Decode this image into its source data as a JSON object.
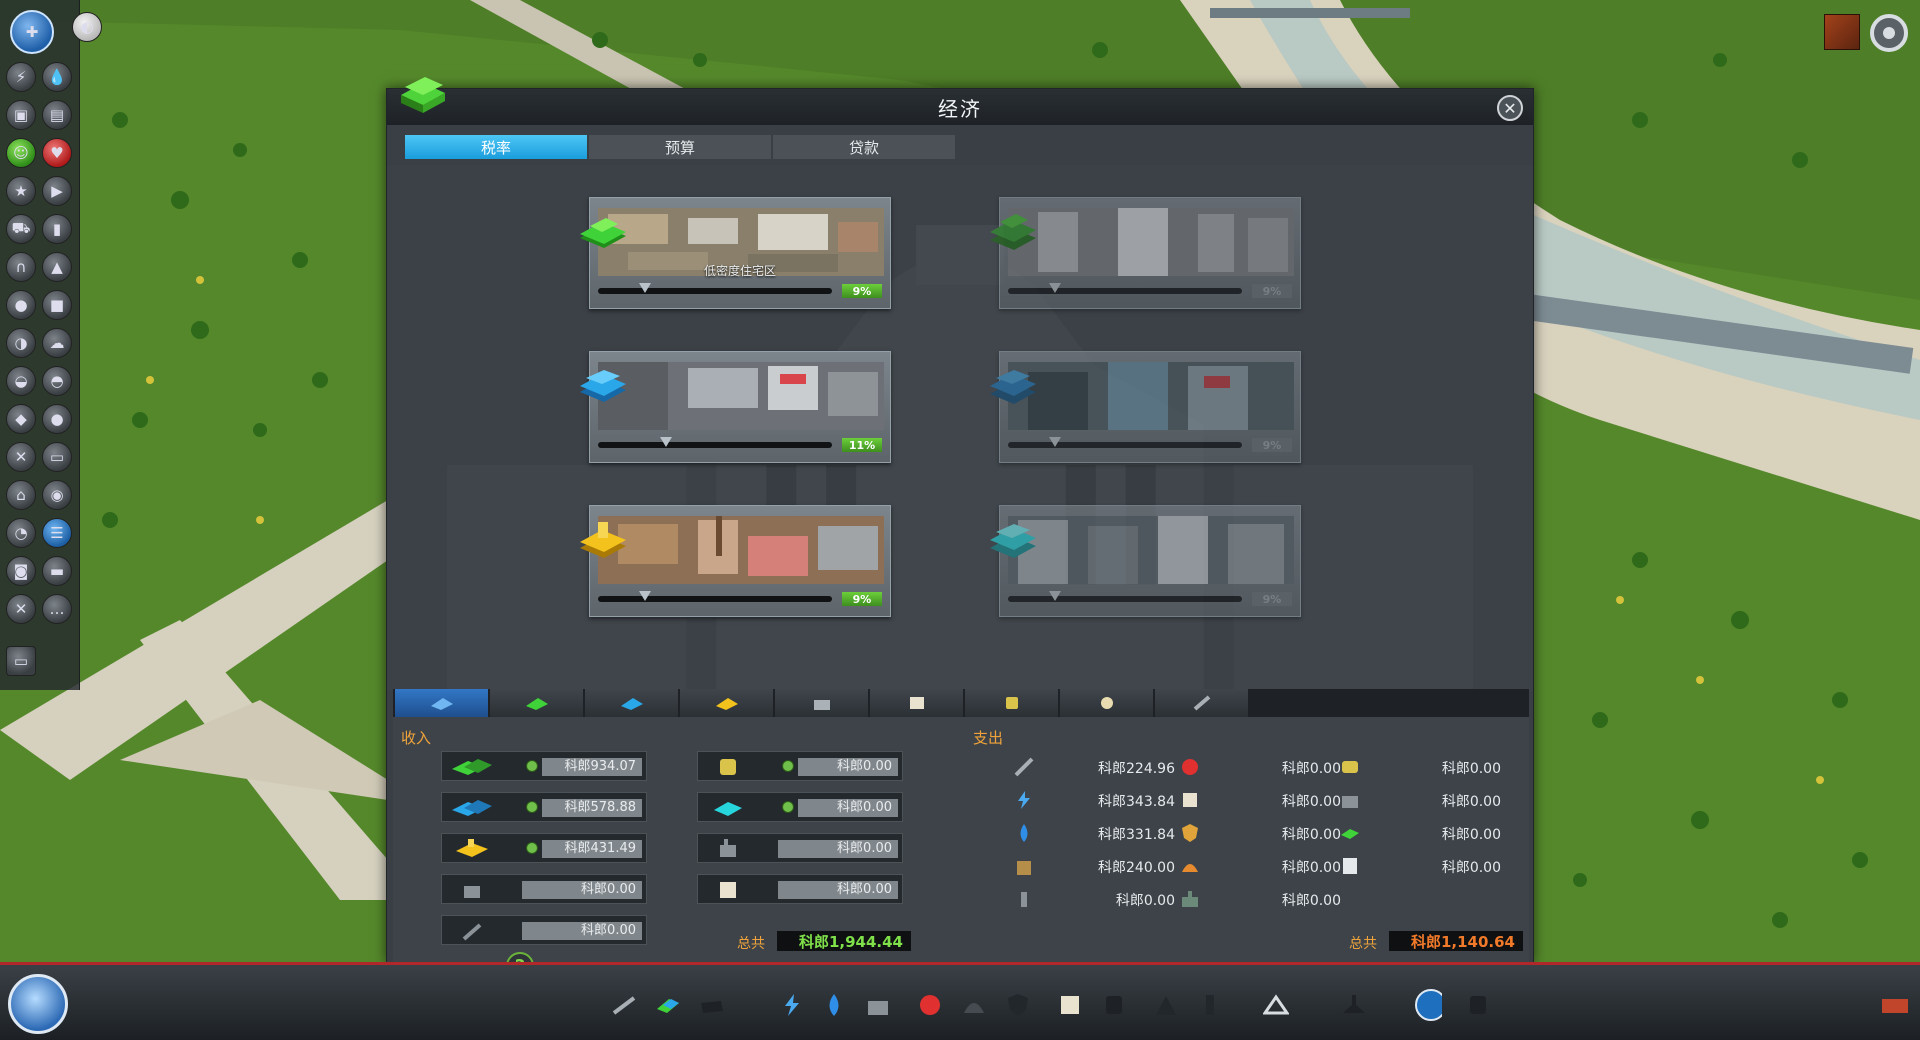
{
  "panel": {
    "title": "经济",
    "tabs": [
      {
        "label": "税率",
        "active": true
      },
      {
        "label": "预算",
        "active": false
      },
      {
        "label": "贷款",
        "active": false
      }
    ]
  },
  "zones": [
    {
      "name": "residential-low",
      "caption": "低密度住宅区",
      "tax": "9%",
      "tax_fraction": 0.2,
      "enabled": true,
      "icon_color": "#3fd339"
    },
    {
      "name": "residential-high",
      "caption": "",
      "tax": "9%",
      "tax_fraction": 0.2,
      "enabled": false,
      "icon_color": "#2f9a2a"
    },
    {
      "name": "commercial-low",
      "caption": "",
      "tax": "11%",
      "tax_fraction": 0.29,
      "enabled": true,
      "icon_color": "#2aa7e8"
    },
    {
      "name": "commercial-high",
      "caption": "",
      "tax": "9%",
      "tax_fraction": 0.2,
      "enabled": false,
      "icon_color": "#1f78b8"
    },
    {
      "name": "industrial",
      "caption": "",
      "tax": "9%",
      "tax_fraction": 0.2,
      "enabled": true,
      "icon_color": "#f3c21c"
    },
    {
      "name": "office",
      "caption": "",
      "tax": "9%",
      "tax_fraction": 0.2,
      "enabled": false,
      "icon_color": "#27d6dc"
    }
  ],
  "budget": {
    "income_label": "收入",
    "expense_label": "支出",
    "income_left": [
      {
        "icon": "residential-income-icon",
        "value": "科郎934.07",
        "locked": false
      },
      {
        "icon": "commercial-income-icon",
        "value": "科郎578.88",
        "locked": false
      },
      {
        "icon": "industrial-income-icon",
        "value": "科郎431.49",
        "locked": false
      },
      {
        "icon": "industry-specialization-icon",
        "value": "科郎0.00",
        "locked": true
      },
      {
        "icon": "road-toll-icon",
        "value": "科郎0.00",
        "locked": true
      }
    ],
    "income_right": [
      {
        "icon": "public-transport-income-icon",
        "value": "科郎0.00",
        "locked": false
      },
      {
        "icon": "office-income-icon",
        "value": "科郎0.00",
        "locked": false
      },
      {
        "icon": "tourism-income-icon",
        "value": "科郎0.00",
        "locked": true
      },
      {
        "icon": "education-income-icon",
        "value": "科郎0.00",
        "locked": true
      }
    ],
    "expense_col1": [
      {
        "icon": "roads-icon",
        "value": "科郎224.96"
      },
      {
        "icon": "electricity-icon",
        "value": "科郎343.84"
      },
      {
        "icon": "water-icon",
        "value": "科郎331.84"
      },
      {
        "icon": "garbage-icon",
        "value": "科郎240.00"
      },
      {
        "icon": "monument-icon",
        "value": "科郎0.00"
      }
    ],
    "expense_col2": [
      {
        "icon": "healthcare-icon",
        "value": "科郎0.00"
      },
      {
        "icon": "education-icon",
        "value": "科郎0.00"
      },
      {
        "icon": "police-icon",
        "value": "科郎0.00"
      },
      {
        "icon": "fire-icon",
        "value": "科郎0.00"
      },
      {
        "icon": "parks-icon",
        "value": "科郎0.00"
      }
    ],
    "expense_col3": [
      {
        "icon": "transport-icon",
        "value": "科郎0.00"
      },
      {
        "icon": "industry-policy-icon",
        "value": "科郎0.00"
      },
      {
        "icon": "unique-buildings-icon",
        "value": "科郎0.00"
      },
      {
        "icon": "policies-icon",
        "value": "科郎0.00"
      }
    ],
    "total_label": "总共",
    "income_total": "科郎1,944.44",
    "expense_total": "科郎1,140.64"
  },
  "colors": {
    "accent": "#1a9ddc",
    "income_total": "#7fe04a",
    "expense_total": "#f07a2a",
    "label": "#f0a33a"
  }
}
